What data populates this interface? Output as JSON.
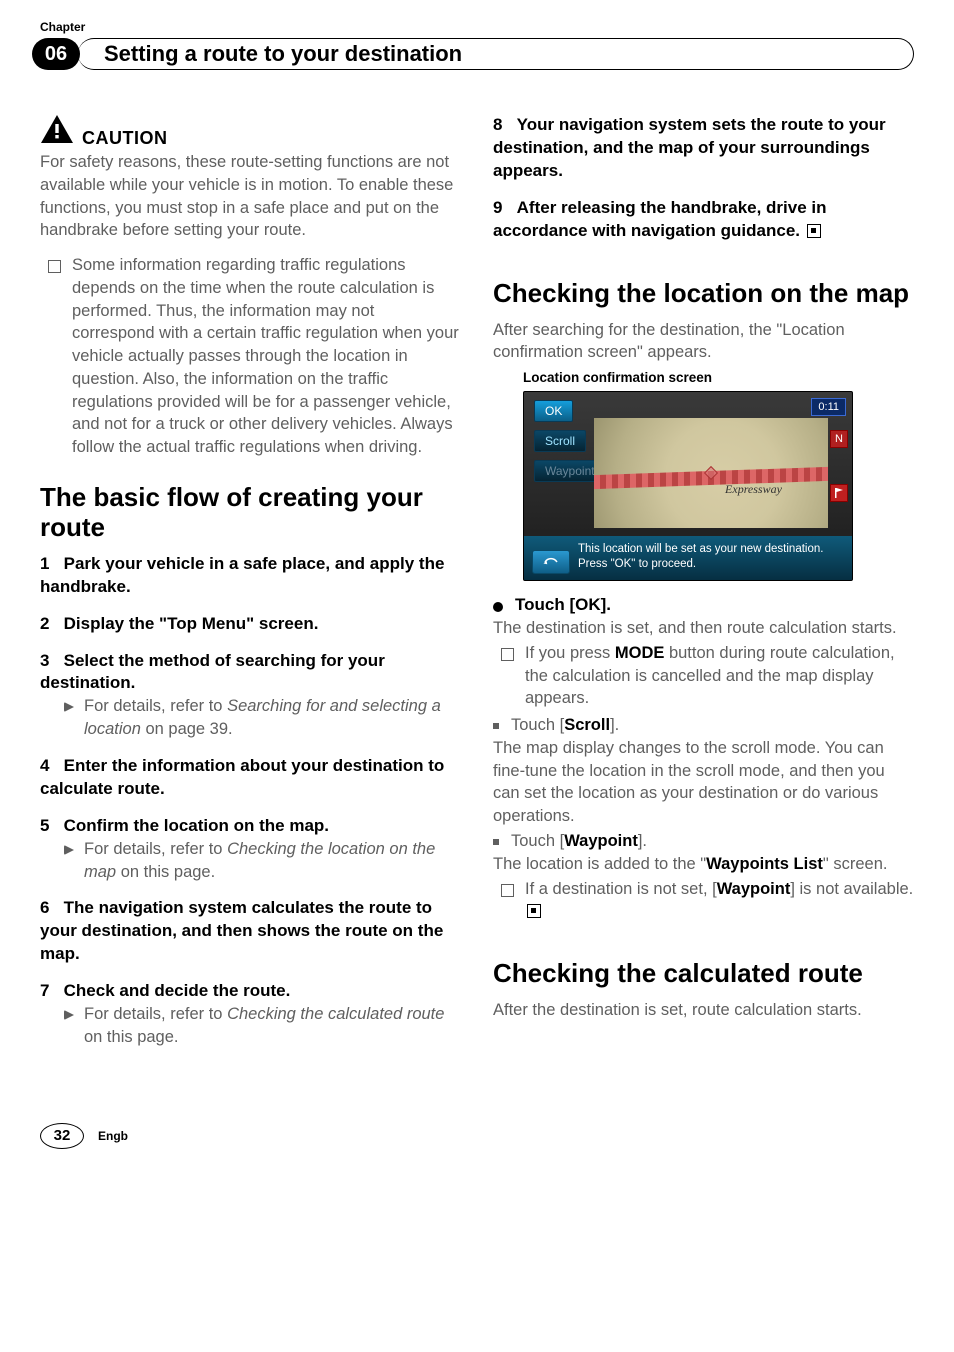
{
  "chapter_label": "Chapter",
  "chapter_number": "06",
  "chapter_title": "Setting a route to your destination",
  "caution": {
    "label": "CAUTION",
    "text": "For safety reasons, these route-setting functions are not available while your vehicle is in motion. To enable these functions, you must stop in a safe place and put on the handbrake before setting your route."
  },
  "caution_note": "Some information regarding traffic regulations depends on the time when the route calculation is performed. Thus, the information may not correspond with a certain traffic regulation when your vehicle actually passes through the location in question. Also, the information on the traffic regulations provided will be for a passenger vehicle, and not for a truck or other delivery vehicles. Always follow the actual traffic regulations when driving.",
  "section_basic_flow": {
    "title": "The basic flow of creating your route",
    "steps": [
      {
        "n": "1",
        "head": "Park your vehicle in a safe place, and apply the handbrake."
      },
      {
        "n": "2",
        "head": "Display the \"Top Menu\" screen."
      },
      {
        "n": "3",
        "head": "Select the method of searching for your destination.",
        "sub_prefix": "For details, refer to ",
        "sub_ital": "Searching for and selecting a location",
        "sub_suffix": " on page 39."
      },
      {
        "n": "4",
        "head": "Enter the information about your destination to calculate route."
      },
      {
        "n": "5",
        "head": "Confirm the location on the map.",
        "sub_prefix": "For details, refer to ",
        "sub_ital": "Checking the location on the map",
        "sub_suffix": " on this page."
      },
      {
        "n": "6",
        "head": "The navigation system calculates the route to your destination, and then shows the route on the map."
      },
      {
        "n": "7",
        "head": "Check and decide the route.",
        "sub_prefix": "For details, refer to ",
        "sub_ital": "Checking the calculated route",
        "sub_suffix": " on this page."
      },
      {
        "n": "8",
        "head": "Your navigation system sets the route to your destination, and the map of your surroundings appears."
      },
      {
        "n": "9",
        "head": "After releasing the handbrake, drive in accordance with navigation guidance."
      }
    ]
  },
  "section_check_location": {
    "title": "Checking the location on the map",
    "intro": "After searching for the destination, the \"Location confirmation screen\" appears.",
    "fig_caption": "Location confirmation screen",
    "screenshot": {
      "ok": "OK",
      "scroll": "Scroll",
      "waypoint": "Waypoint",
      "timer": "0:11",
      "north": "N",
      "flag": "",
      "road_label": "Expressway",
      "footer_line1": "This location will be set as your new destination.",
      "footer_line2": "Press \"OK\" to proceed."
    },
    "touch_ok_label": "Touch [OK].",
    "touch_ok_body": "The destination is set, and then route calculation starts.",
    "mode_note_prefix": "If you press ",
    "mode_note_bold": "MODE",
    "mode_note_suffix": " button during route calculation, the calculation is cancelled and the map display appears.",
    "touch_scroll_prefix": "Touch [",
    "touch_scroll_bold": "Scroll",
    "touch_scroll_suffix": "].",
    "scroll_body": "The map display changes to the scroll mode. You can fine-tune the location in the scroll mode, and then you can set the location as your destination or do various operations.",
    "touch_wp_prefix": "Touch [",
    "touch_wp_bold": "Waypoint",
    "touch_wp_suffix": "].",
    "wp_body_prefix": "The location is added to the \"",
    "wp_body_bold": "Waypoints List",
    "wp_body_suffix": "\" screen.",
    "wp_note_prefix": "If a destination is not set, [",
    "wp_note_bold": "Waypoint",
    "wp_note_suffix": "] is not available."
  },
  "section_check_route": {
    "title": "Checking the calculated route",
    "intro": "After the destination is set, route calculation starts."
  },
  "footer": {
    "page": "32",
    "lang": "Engb"
  }
}
